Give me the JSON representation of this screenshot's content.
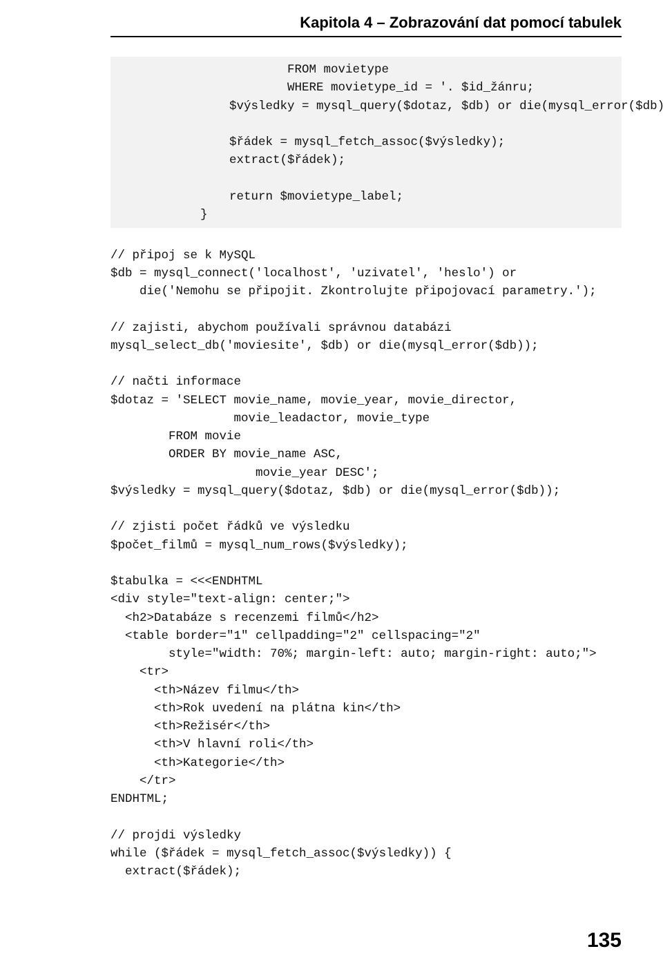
{
  "header": {
    "title": "Kapitola 4 – Zobrazování dat pomocí tabulek"
  },
  "code": {
    "top": "            FROM movietype\n            WHERE movietype_id = '. $id_žánru;\n    $výsledky = mysql_query($dotaz, $db) or die(mysql_error($db));\n\n    $řádek = mysql_fetch_assoc($výsledky);\n    extract($řádek);\n\n    return $movietype_label;\n}",
    "rest": "\n// připoj se k MySQL\n$db = mysql_connect('localhost', 'uzivatel', 'heslo') or\n    die('Nemohu se připojit. Zkontrolujte připojovací parametry.');\n\n// zajisti, abychom používali správnou databázi\nmysql_select_db('moviesite', $db) or die(mysql_error($db));\n\n// načti informace\n$dotaz = 'SELECT movie_name, movie_year, movie_director,\n                 movie_leadactor, movie_type\n        FROM movie\n        ORDER BY movie_name ASC,\n                    movie_year DESC';\n$výsledky = mysql_query($dotaz, $db) or die(mysql_error($db));\n\n// zjisti počet řádků ve výsledku\n$počet_filmů = mysql_num_rows($výsledky);\n\n$tabulka = <<<ENDHTML\n<div style=\"text-align: center;\">\n  <h2>Databáze s recenzemi filmů</h2>\n  <table border=\"1\" cellpadding=\"2\" cellspacing=\"2\"\n        style=\"width: 70%; margin-left: auto; margin-right: auto;\">\n    <tr>\n      <th>Název filmu</th>\n      <th>Rok uvedení na plátna kin</th>\n      <th>Režisér</th>\n      <th>V hlavní roli</th>\n      <th>Kategorie</th>\n    </tr>\nENDHTML;\n\n// projdi výsledky\nwhile ($řádek = mysql_fetch_assoc($výsledky)) {\n  extract($řádek);"
  },
  "page_number": "135"
}
